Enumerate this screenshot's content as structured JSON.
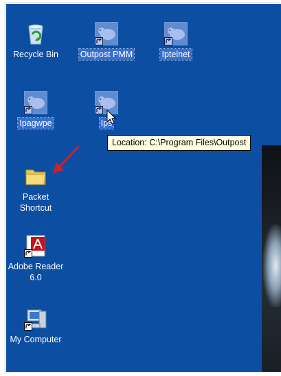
{
  "desktop": {
    "background_color": "#0b4ea2",
    "icons": [
      {
        "label": "Recycle Bin",
        "icon": "recycle-bin-icon",
        "selected": false,
        "shortcut": false
      },
      {
        "label": "Outpost PMM",
        "icon": "polar-bear-icon",
        "selected": true,
        "shortcut": true
      },
      {
        "label": "Iptelnet",
        "icon": "polar-bear-icon",
        "selected": true,
        "shortcut": true
      },
      {
        "label": "Ipagwpe",
        "icon": "polar-bear-icon",
        "selected": true,
        "shortcut": true
      },
      {
        "label": "Ips",
        "icon": "polar-bear-icon",
        "selected": true,
        "shortcut": true
      },
      {
        "label": "Packet\nShortcut",
        "icon": "folder-icon",
        "selected": false,
        "shortcut": false
      },
      {
        "label": "Adobe Reader\n6.0",
        "icon": "adobe-reader-icon",
        "selected": false,
        "shortcut": true
      },
      {
        "label": "My Computer",
        "icon": "my-computer-icon",
        "selected": false,
        "shortcut": true
      }
    ]
  },
  "tooltip": {
    "text": "Location: C:\\Program Files\\Outpost"
  },
  "colors": {
    "tooltip_bg": "#ffffe1",
    "selection": "#3a6fce",
    "annotation_arrow": "#d0202a"
  }
}
